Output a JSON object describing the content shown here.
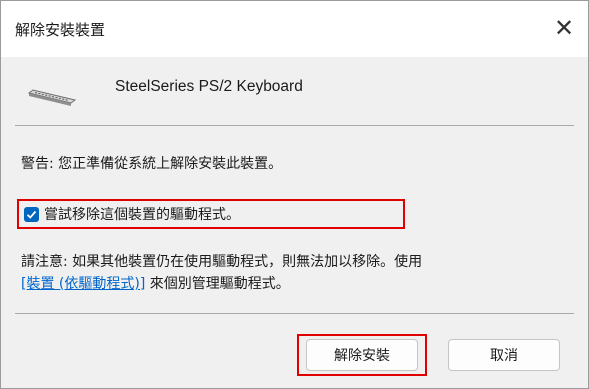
{
  "window": {
    "title": "解除安裝裝置",
    "close_glyph": "✕"
  },
  "device": {
    "name": "SteelSeries PS/2 Keyboard",
    "icon": "keyboard-icon"
  },
  "warning": "警告: 您正準備從系統上解除安裝此裝置。",
  "checkbox": {
    "label": "嘗試移除這個裝置的驅動程式。",
    "checked": true
  },
  "note": {
    "line1": "請注意: 如果其他裝置仍在使用驅動程式，則無法加以移除。使用",
    "link": "[裝置 (依驅動程式)]",
    "line2_rest": " 來個別管理驅動程式。"
  },
  "buttons": {
    "uninstall": "解除安裝",
    "cancel": "取消"
  },
  "colors": {
    "highlight_box": "#e00000",
    "checkbox_fill": "#0067c0",
    "link": "#0066cc"
  }
}
